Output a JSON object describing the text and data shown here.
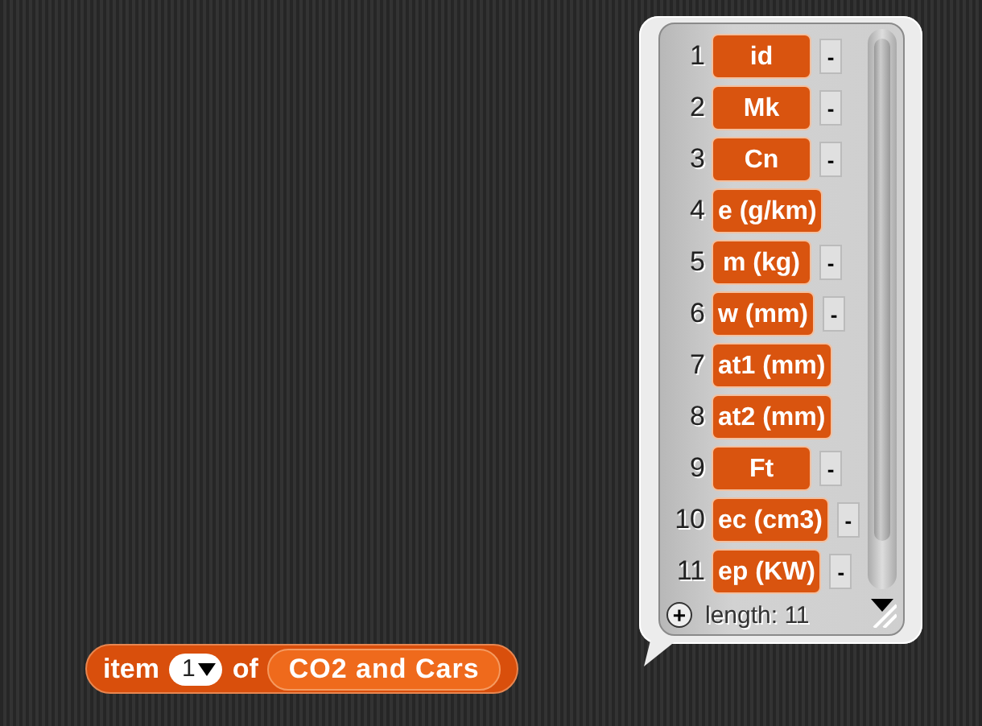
{
  "list_bubble": {
    "items": [
      {
        "index": "1",
        "value": "id",
        "remove": "-"
      },
      {
        "index": "2",
        "value": "Mk",
        "remove": "-"
      },
      {
        "index": "3",
        "value": "Cn",
        "remove": "-"
      },
      {
        "index": "4",
        "value": "e (g/km)"
      },
      {
        "index": "5",
        "value": "m (kg)",
        "remove": "-"
      },
      {
        "index": "6",
        "value": "w (mm)",
        "remove": "-"
      },
      {
        "index": "7",
        "value": "at1 (mm)"
      },
      {
        "index": "8",
        "value": "at2 (mm)"
      },
      {
        "index": "9",
        "value": "Ft",
        "remove": "-"
      },
      {
        "index": "10",
        "value": "ec (cm3)",
        "remove": "-"
      },
      {
        "index": "11",
        "value": "ep (KW)",
        "remove": "-"
      }
    ],
    "add": "+",
    "length": "length: 11"
  },
  "block": {
    "label": "item",
    "index": "1",
    "of": "of",
    "list": "CO2 and Cars"
  }
}
